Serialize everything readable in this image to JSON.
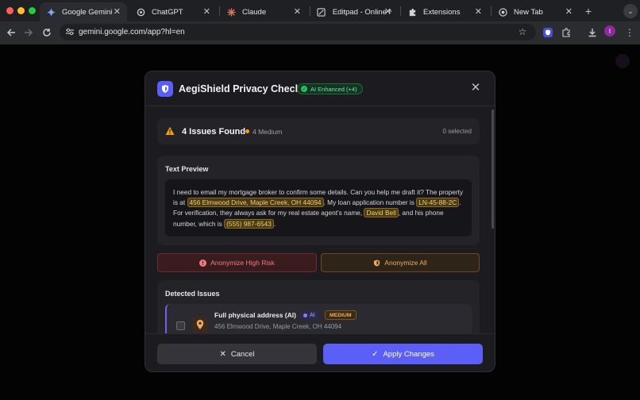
{
  "browser": {
    "tabs": [
      {
        "title": "Google Gemini",
        "icon": "gemini-icon",
        "active": true
      },
      {
        "title": "ChatGPT",
        "icon": "chatgpt-icon"
      },
      {
        "title": "Claude",
        "icon": "claude-icon"
      },
      {
        "title": "Editpad - Online No",
        "icon": "editpad-icon"
      },
      {
        "title": "Extensions",
        "icon": "puzzle-icon"
      },
      {
        "title": "New Tab",
        "icon": "chrome-icon"
      }
    ],
    "url": "gemini.google.com/app?hl=en",
    "profile_initial": "I"
  },
  "modal": {
    "title": "AegiShield Privacy Check",
    "ai_badge": "AI Enhanced (+4)",
    "summary": {
      "title": "4 Issues Found",
      "severity": "4 Medium",
      "selected": "0 selected"
    },
    "preview": {
      "label": "Text Preview",
      "segments": [
        {
          "text": "I need to email my mortgage broker to confirm some details. Can you help me draft it? The property is at ",
          "hl": false
        },
        {
          "text": "456 Elmwood Drive, Maple Creek, OH 44094",
          "hl": true
        },
        {
          "text": ". My loan application number is ",
          "hl": false
        },
        {
          "text": "LN-45-88-2C",
          "hl": true
        },
        {
          "text": ". For verification, they always ask for my real estate agent's name, ",
          "hl": false
        },
        {
          "text": "David Bell",
          "hl": true
        },
        {
          "text": ", and his phone number, which is ",
          "hl": false
        },
        {
          "text": "(555) 987-6543",
          "hl": true
        },
        {
          "text": ".",
          "hl": false
        }
      ]
    },
    "actions": {
      "anonymize_high": "Anonymize High Risk",
      "anonymize_all": "Anonymize All"
    },
    "detected": {
      "label": "Detected Issues",
      "items": [
        {
          "title": "Full physical address (AI)",
          "ai_tag": "AI",
          "severity": "MEDIUM",
          "value": "456 Elmwood Drive, Maple Creek, OH 44094"
        }
      ]
    },
    "footer": {
      "cancel": "Cancel",
      "apply": "Apply Changes"
    }
  },
  "colors": {
    "accent": "#5b5ef7",
    "highlight": "#f6cf6a",
    "danger": "#f07a7e",
    "warning": "#f0ac5a",
    "success": "#22c55e"
  }
}
